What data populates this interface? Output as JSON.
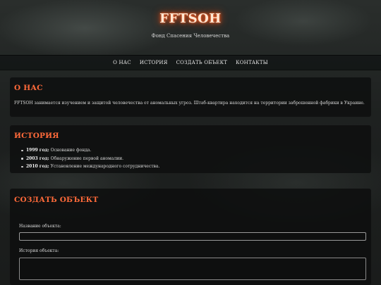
{
  "header": {
    "title": "FFTSOH",
    "subtitle": "Фонд Спасения Человечества"
  },
  "nav": {
    "items": [
      {
        "label": "О НАС"
      },
      {
        "label": "ИСТОРИЯ"
      },
      {
        "label": "СОЗДАТЬ ОБЪЕКТ"
      },
      {
        "label": "КОНТАКТЫ"
      }
    ]
  },
  "about": {
    "title": "О НАС",
    "text": "FFTSOH занимается изучением и защитой человечества от аномальных угроз. Штаб-квартира находится на территории заброшенной фабрики в Украине."
  },
  "history": {
    "title": "ИСТОРИЯ",
    "items": [
      {
        "year": "1999 год:",
        "text": "Основание фонда."
      },
      {
        "year": "2003 год:",
        "text": "Обнаружение первой аномалии."
      },
      {
        "year": "2010 год:",
        "text": "Установление международного сотрудничества."
      }
    ]
  },
  "create": {
    "title": "СОЗДАТЬ ОБЪЕКТ",
    "name_label": "Название объекта:",
    "name_value": "",
    "history_label": "История объекта:",
    "history_value": ""
  },
  "colors": {
    "accent": "#ff6a3a",
    "title_glow": "#ff5a1f",
    "panel_bg": "#0e0f0f"
  }
}
